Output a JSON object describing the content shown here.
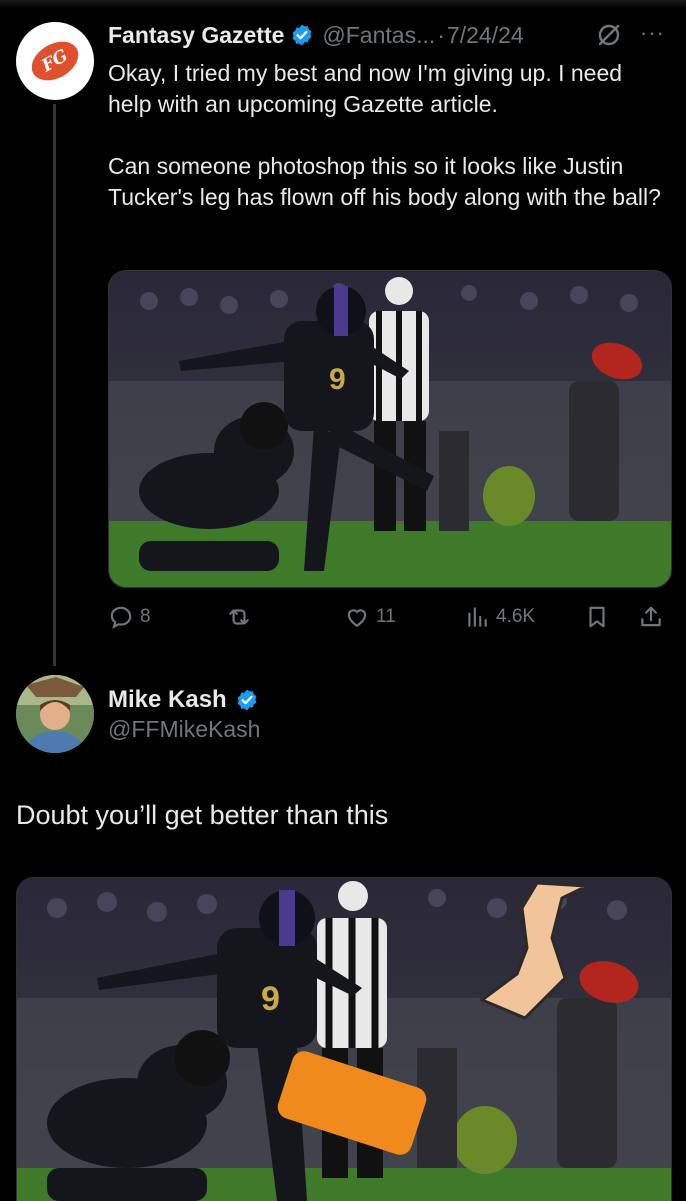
{
  "tweet1": {
    "display_name": "Fantasy Gazette",
    "handle": "@Fantas...",
    "date_sep": "·",
    "date": "7/24/24",
    "avatar_initials": "FG",
    "paragraph1": "Okay, I tried my best and now I'm giving up. I need help with an upcoming Gazette article.",
    "paragraph2": "Can someone photoshop this so it looks like Justin Tucker's leg has flown off his body along with the ball?",
    "more_label": "···",
    "stats": {
      "replies": "8",
      "retweets": "",
      "likes": "11",
      "views": "4.6K"
    }
  },
  "tweet2": {
    "display_name": "Mike Kash",
    "handle": "@FFMikeKash",
    "text": "Doubt you’ll get better than this"
  },
  "colors": {
    "background": "#000000",
    "text": "#e7e9ea",
    "muted": "#71767b",
    "verified": "#1d9bf0",
    "field": "#3f7a2a",
    "jersey": "#1a1a24",
    "leg_patch": "#f08a1c",
    "leg_cutout": "#f2c49a",
    "ball": "#b3261e"
  },
  "icons": [
    "verified-badge-icon",
    "grok-icon",
    "more-icon",
    "reply-icon",
    "retweet-icon",
    "like-icon",
    "views-icon",
    "bookmark-icon",
    "share-icon"
  ]
}
